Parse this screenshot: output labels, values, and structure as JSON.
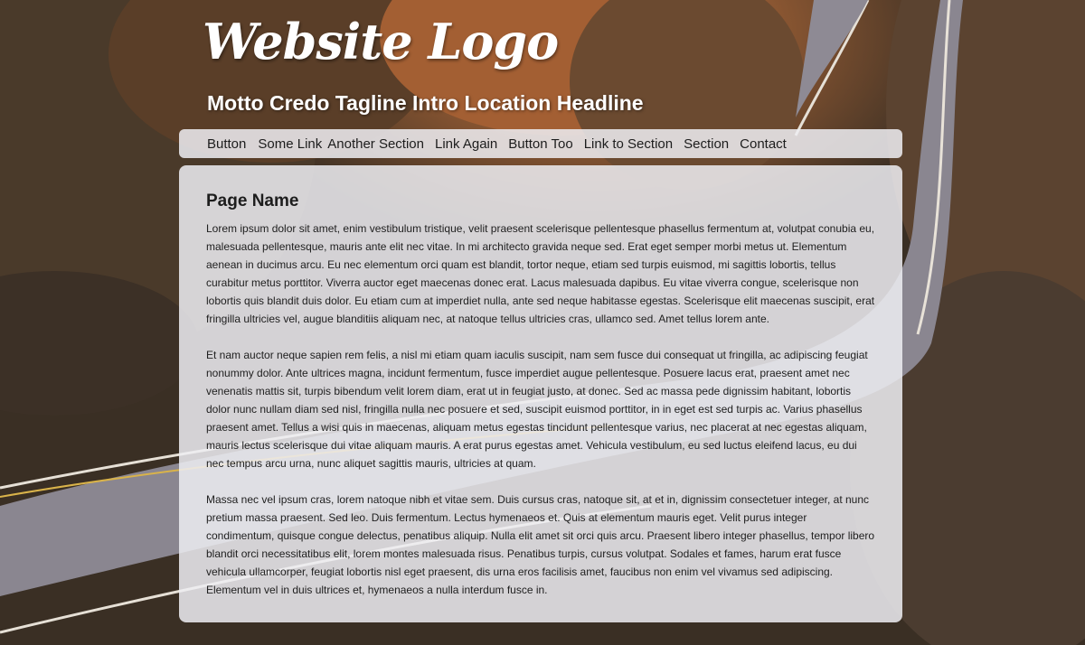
{
  "header": {
    "logo": "Website Logo",
    "tagline": "Motto Credo Tagline Intro Location Headline"
  },
  "nav": {
    "items": [
      "Button",
      "Some Link",
      "Another Section",
      "Link Again",
      "Button Too",
      "Link to Section",
      "Section",
      "Contact"
    ]
  },
  "main": {
    "title": "Page Name",
    "paragraphs": [
      "Lorem ipsum dolor sit amet, enim vestibulum tristique, velit praesent scelerisque pellentesque phasellus fermentum at, volutpat conubia eu, malesuada pellentesque, mauris ante elit nec vitae. In mi architecto gravida neque sed. Erat eget semper morbi metus ut. Elementum aenean in ducimus arcu. Eu nec elementum orci quam est blandit, tortor neque, etiam sed turpis euismod, mi sagittis lobortis, tellus curabitur metus porttitor. Viverra auctor eget maecenas donec erat. Lacus malesuada dapibus. Eu vitae viverra congue, scelerisque non lobortis quis blandit duis dolor. Eu etiam cum at imperdiet nulla, ante sed neque habitasse egestas. Scelerisque elit maecenas suscipit, erat fringilla ultricies vel, augue blanditiis aliquam nec, at natoque tellus ultricies cras, ullamco sed. Amet tellus lorem ante.",
      "Et nam auctor neque sapien rem felis, a nisl mi etiam quam iaculis suscipit, nam sem fusce dui consequat ut fringilla, ac adipiscing feugiat nonummy dolor. Ante ultrices magna, incidunt fermentum, fusce imperdiet augue pellentesque. Posuere lacus erat, praesent amet nec venenatis mattis sit, turpis bibendum velit lorem diam, erat ut in feugiat justo, at donec. Sed ac massa pede dignissim habitant, lobortis dolor nunc nullam diam sed nisl, fringilla nulla nec posuere et sed, suscipit euismod porttitor, in in eget est sed turpis ac. Varius phasellus praesent amet. Tellus a wisi quis in maecenas, aliquam metus egestas tincidunt pellentesque varius, nec placerat at nec egestas aliquam, mauris lectus scelerisque dui vitae aliquam mauris. A erat purus egestas amet. Vehicula vestibulum, eu sed luctus eleifend lacus, eu dui nec tempus arcu urna, nunc aliquet sagittis mauris, ultricies at quam.",
      "Massa nec vel ipsum cras, lorem natoque nibh et vitae sem. Duis cursus cras, natoque sit, at et in, dignissim consectetuer integer, at nunc pretium massa praesent. Sed leo. Duis fermentum. Lectus hymenaeos et. Quis at elementum mauris eget. Velit purus integer condimentum, quisque congue delectus, penatibus aliquip. Nulla elit amet sit orci quis arcu. Praesent libero integer phasellus, tempor libero blandit orci necessitatibus elit, lorem montes malesuada risus. Penatibus turpis, cursus volutpat. Sodales et fames, harum erat fusce vehicula ullamcorper, feugiat lobortis nisl eget praesent, dis urna eros facilisis amet, faucibus non enim vel vivamus sed adipiscing. Elementum vel in duis ultrices et, hymenaeos a nulla interdum fusce in."
    ]
  },
  "colors": {
    "panel_bg": "#eeeef2",
    "text": "#202020",
    "header_text": "#ffffff",
    "accent_orange": "#c8743a"
  },
  "icons": [
    "road-landscape-background-image"
  ]
}
